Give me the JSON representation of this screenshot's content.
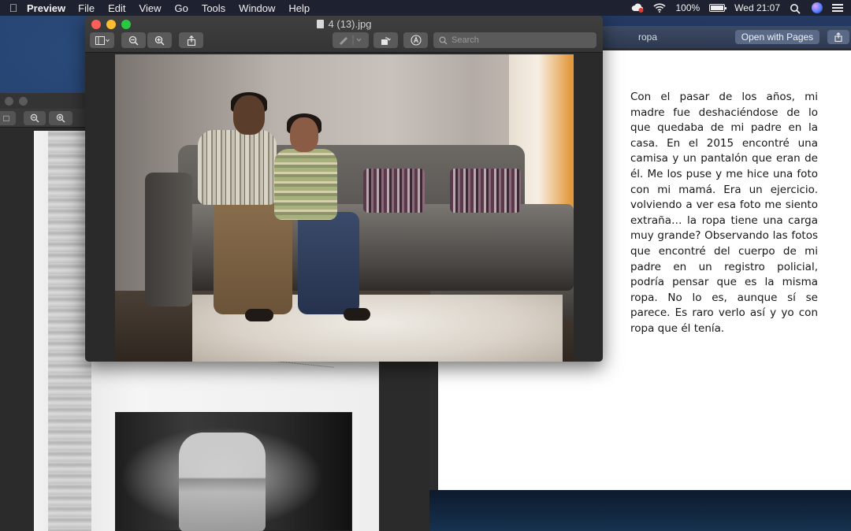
{
  "menubar": {
    "app_name": "Preview",
    "menus": [
      "File",
      "Edit",
      "View",
      "Go",
      "Tools",
      "Window",
      "Help"
    ],
    "battery_percent_label": "100%",
    "battery_level": 1.0,
    "clock": "Wed 21:07",
    "status_icons": [
      "creative-cloud-icon",
      "wifi-icon",
      "battery-icon",
      "search-icon",
      "siri-icon",
      "control-center-icon"
    ]
  },
  "front_window": {
    "title": "4 (13).jpg",
    "search_placeholder": "Search",
    "toolbar_icons": [
      "sidebar-icon",
      "zoom-out-icon",
      "zoom-in-icon",
      "share-icon",
      "markup-pen-icon",
      "rotate-icon",
      "annotate-icon"
    ]
  },
  "right_window": {
    "title": "ropa",
    "open_with_pages_label": "Open with Pages",
    "document_text": "Con el pasar de los años, mi madre fue deshaciéndose de lo que quedaba de mi padre en la casa. En el 2015 encontré una camisa y un pantalón que eran de él. Me los puse y me hice una foto con mi mamá. Era un ejercicio. volviendo a ver esa foto me siento extraña… la ropa tiene una carga muy grande? Observando las fotos que encontré del cuerpo de mi padre en un registro policial, podría pensar que es la misma ropa. No lo es, aunque sí se parece. Es raro verlo así y yo con ropa que él tenía."
  },
  "colors": {
    "menubar_bg": "#1e2230",
    "window_dark": "#2a2a2a",
    "traffic_close": "#ff5f57",
    "traffic_min": "#febc2e",
    "traffic_max": "#28c840",
    "accent_toolbar": "#3d4a63"
  }
}
